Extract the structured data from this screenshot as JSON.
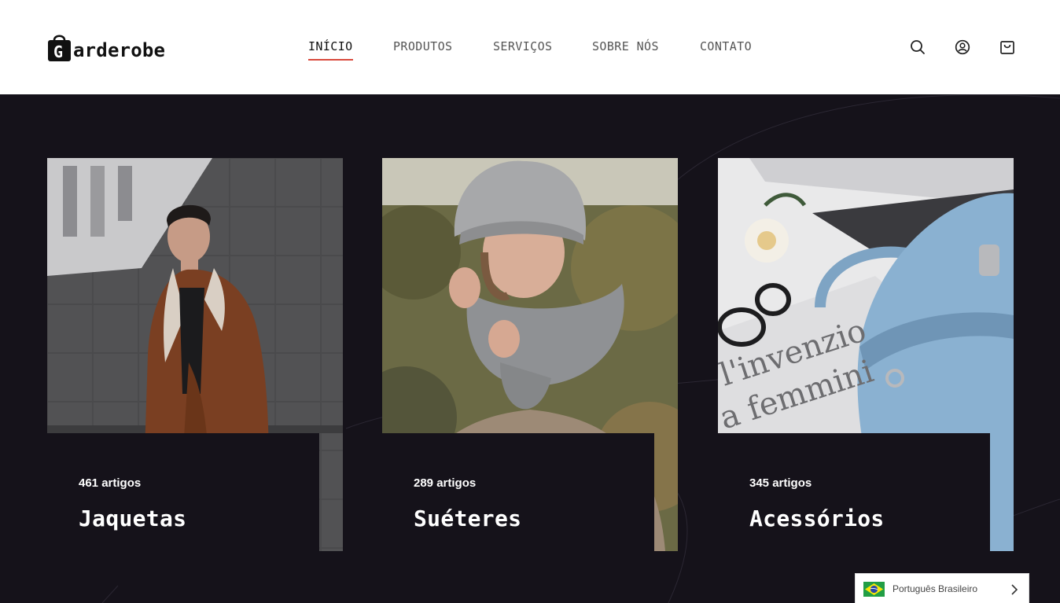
{
  "logo": {
    "letter": "G",
    "text": "arderobe"
  },
  "nav": {
    "items": [
      {
        "label": "INÍCIO",
        "active": true
      },
      {
        "label": "PRODUTOS",
        "active": false
      },
      {
        "label": "SERVIÇOS",
        "active": false
      },
      {
        "label": "SOBRE NÓS",
        "active": false
      },
      {
        "label": "CONTATO",
        "active": false
      }
    ]
  },
  "header_icons": [
    "search-icon",
    "user-icon",
    "cart-icon"
  ],
  "categories": [
    {
      "count": "461 artigos",
      "title": "Jaquetas",
      "image": "man in brown shearling jacket against grey tiled wall"
    },
    {
      "count": "289 artigos",
      "title": "Suéteres",
      "image": "woman in grey knit hat and scarf with beige sweater"
    },
    {
      "count": "345 artigos",
      "title": "Acessórios",
      "image": "light blue handbag with glasses, rose and magazines"
    }
  ],
  "language": {
    "label": "Português Brasileiro",
    "flag": "brazil-flag"
  },
  "colors": {
    "accent": "#d94a3d",
    "hero_bg": "#15121a",
    "header_bg": "#ffffff"
  }
}
